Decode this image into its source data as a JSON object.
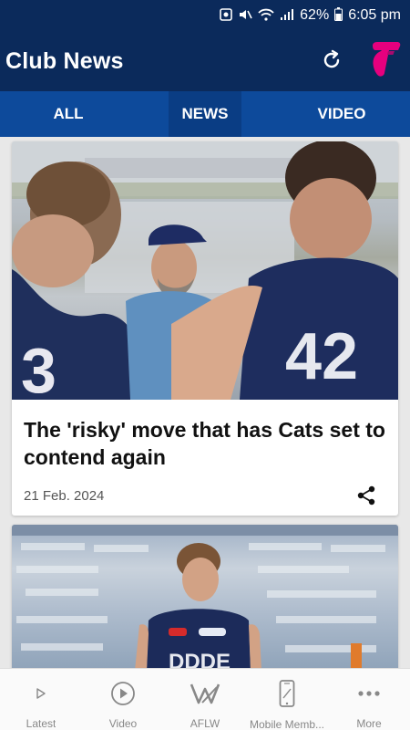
{
  "status_bar": {
    "battery": "62%",
    "time": "6:05 pm"
  },
  "app_bar": {
    "title": "Club News"
  },
  "tabs": [
    {
      "label": "ALL"
    },
    {
      "label": "NEWS",
      "selected": true
    },
    {
      "label": "VIDEO"
    }
  ],
  "articles": [
    {
      "headline": "The 'risky' move that has Cats set to contend again",
      "date": "21 Feb. 2024",
      "image": "coach-with-players-photo"
    },
    {
      "image": "player-in-stadium-photo"
    }
  ],
  "bottom_nav": [
    {
      "label": "Latest",
      "icon": "play-outline-icon"
    },
    {
      "label": "Video",
      "icon": "play-circle-icon"
    },
    {
      "label": "AFLW",
      "icon": "aflw-logo-icon"
    },
    {
      "label": "Mobile Memb...",
      "icon": "phone-card-icon"
    },
    {
      "label": "More",
      "icon": "more-dots-icon"
    }
  ],
  "colors": {
    "header": "#0b2a5b",
    "tabs": "#0d4a9b",
    "telstra": "#e6007e"
  }
}
